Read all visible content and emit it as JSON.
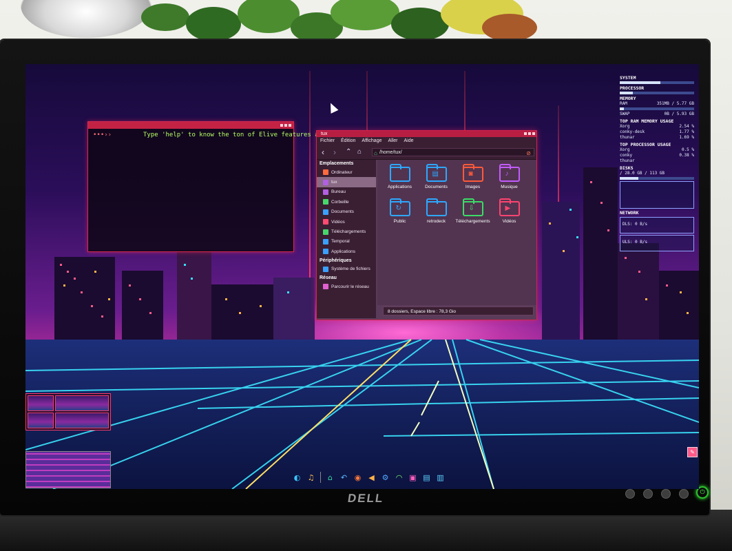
{
  "monitor": {
    "brand": "DELL",
    "power_glyph": "⏻"
  },
  "terminal": {
    "prompt": "•••››",
    "message": "Type 'help' to know the ton of Elive features available..."
  },
  "file_manager": {
    "title": "tux",
    "menu": [
      "Fichier",
      "Édition",
      "Affichage",
      "Aller",
      "Aide"
    ],
    "path": "/home/tux/",
    "sidebar": {
      "places_header": "Emplacements",
      "places": [
        {
          "label": "Ordinateur",
          "color": "#ff6b3d"
        },
        {
          "label": "tux",
          "color": "#b060e0",
          "selected": true
        },
        {
          "label": "Bureau",
          "color": "#b060e0"
        },
        {
          "label": "Corbeille",
          "color": "#47d66b"
        },
        {
          "label": "Documents",
          "color": "#3aa0ff"
        },
        {
          "label": "Vidéos",
          "color": "#ff4b70"
        },
        {
          "label": "Téléchargements",
          "color": "#47d66b"
        },
        {
          "label": "Temporal",
          "color": "#3aa0ff"
        },
        {
          "label": "Applications",
          "color": "#3aa0ff"
        }
      ],
      "devices_header": "Périphériques",
      "devices": [
        {
          "label": "Système de fichiers",
          "color": "#3aa0ff"
        }
      ],
      "network_header": "Réseau",
      "network": [
        {
          "label": "Parcourir le réseau",
          "color": "#e060d0"
        }
      ]
    },
    "folders": [
      {
        "label": "Applications",
        "color": "#2ea8ff",
        "glyph": ""
      },
      {
        "label": "Documents",
        "color": "#2ea8ff",
        "glyph": "▤"
      },
      {
        "label": "Images",
        "color": "#ff5a3a",
        "glyph": "◙"
      },
      {
        "label": "Musique",
        "color": "#c35cff",
        "glyph": "♪"
      },
      {
        "label": "Public",
        "color": "#2ea8ff",
        "glyph": "↻"
      },
      {
        "label": "retrodeck",
        "color": "#2ea8ff",
        "glyph": ""
      },
      {
        "label": "Téléchargements",
        "color": "#3bdc66",
        "glyph": "⇩"
      },
      {
        "label": "Vidéos",
        "color": "#ff4470",
        "glyph": "▶"
      }
    ],
    "status": "8 dossiers, Espace libre : 78,3 Gio"
  },
  "conky": {
    "system_header": "SYSTEM",
    "processor_header": "PROCESSOR",
    "memory_header": "MEMORY",
    "ram_label": "RAM",
    "ram_value": "351MB / 5.77 GB",
    "ram_fraction": 0.06,
    "swap_label": "SWAP",
    "swap_value": "0B / 5.93 GB",
    "swap_fraction": 0.0,
    "top_ram_header": "TOP RAM MEMORY USAGE",
    "top_ram": [
      [
        "Xorg",
        "2.54 %"
      ],
      [
        "conky-desk",
        "1.77 %"
      ],
      [
        "thunar",
        "1.69 %"
      ]
    ],
    "top_proc_header": "TOP PROCESSOR USAGE",
    "top_proc": [
      [
        "Xorg",
        "0.5 %"
      ],
      [
        "conky",
        "0.38 %"
      ],
      [
        "thunar",
        ""
      ]
    ],
    "disks_header": "DISKS",
    "disk_root": "/ 28.0 GB / 113 GB",
    "disk_fraction": 0.25,
    "network_header": "NETWORK",
    "down_label": "DLS: 0 B/s",
    "up_label": "ULS: 0 B/s"
  },
  "dock": {
    "icons": [
      {
        "name": "elive-menu-icon",
        "glyph": "◐",
        "color": "#39c6ff"
      },
      {
        "name": "music-icon",
        "glyph": "♫",
        "color": "#ffc14a"
      },
      {
        "name": "folder-home-icon",
        "glyph": "⌂",
        "color": "#37d7a2"
      },
      {
        "name": "undo-icon",
        "glyph": "↶",
        "color": "#5ab8ff"
      },
      {
        "name": "camera-icon",
        "glyph": "◉",
        "color": "#ff7a3a"
      },
      {
        "name": "volume-icon",
        "glyph": "◀",
        "color": "#ffb347"
      },
      {
        "name": "settings-icon",
        "glyph": "⚙",
        "color": "#52a8ff"
      },
      {
        "name": "wifi-icon",
        "glyph": "◠",
        "color": "#7cff6b"
      },
      {
        "name": "terminal-icon",
        "glyph": "▣",
        "color": "#ff5fbf"
      },
      {
        "name": "image-viewer-icon",
        "glyph": "▤",
        "color": "#5ad1ff"
      },
      {
        "name": "trash-icon",
        "glyph": "▥",
        "color": "#5ad1ff"
      }
    ]
  }
}
